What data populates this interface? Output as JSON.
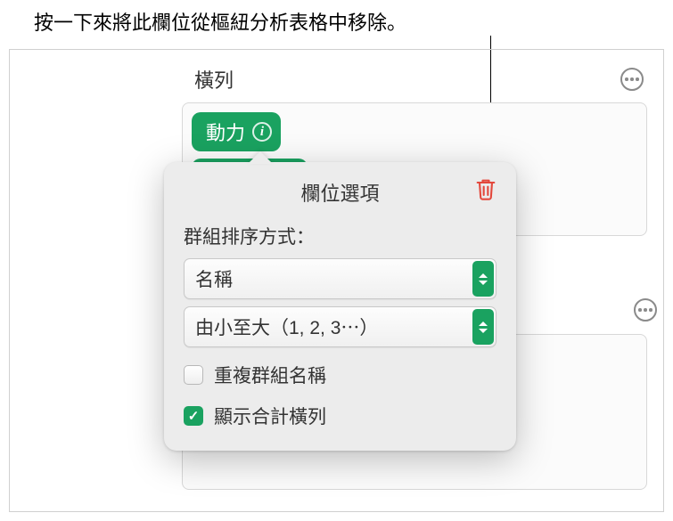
{
  "annotation": {
    "text": "按一下來將此欄位從樞紐分析表格中移除。"
  },
  "section": {
    "title": "橫列"
  },
  "pill": {
    "label": "動力"
  },
  "popover": {
    "title": "欄位選項",
    "group_sort_label": "群組排序方式：",
    "sort_by_value": "名稱",
    "sort_order_value": "由小至大（1, 2, 3⋯）",
    "repeat_groups_label": "重複群組名稱",
    "repeat_groups_checked": false,
    "show_totals_label": "顯示合計橫列",
    "show_totals_checked": true
  },
  "icons": {
    "info": "i",
    "checkmark": "✓"
  }
}
